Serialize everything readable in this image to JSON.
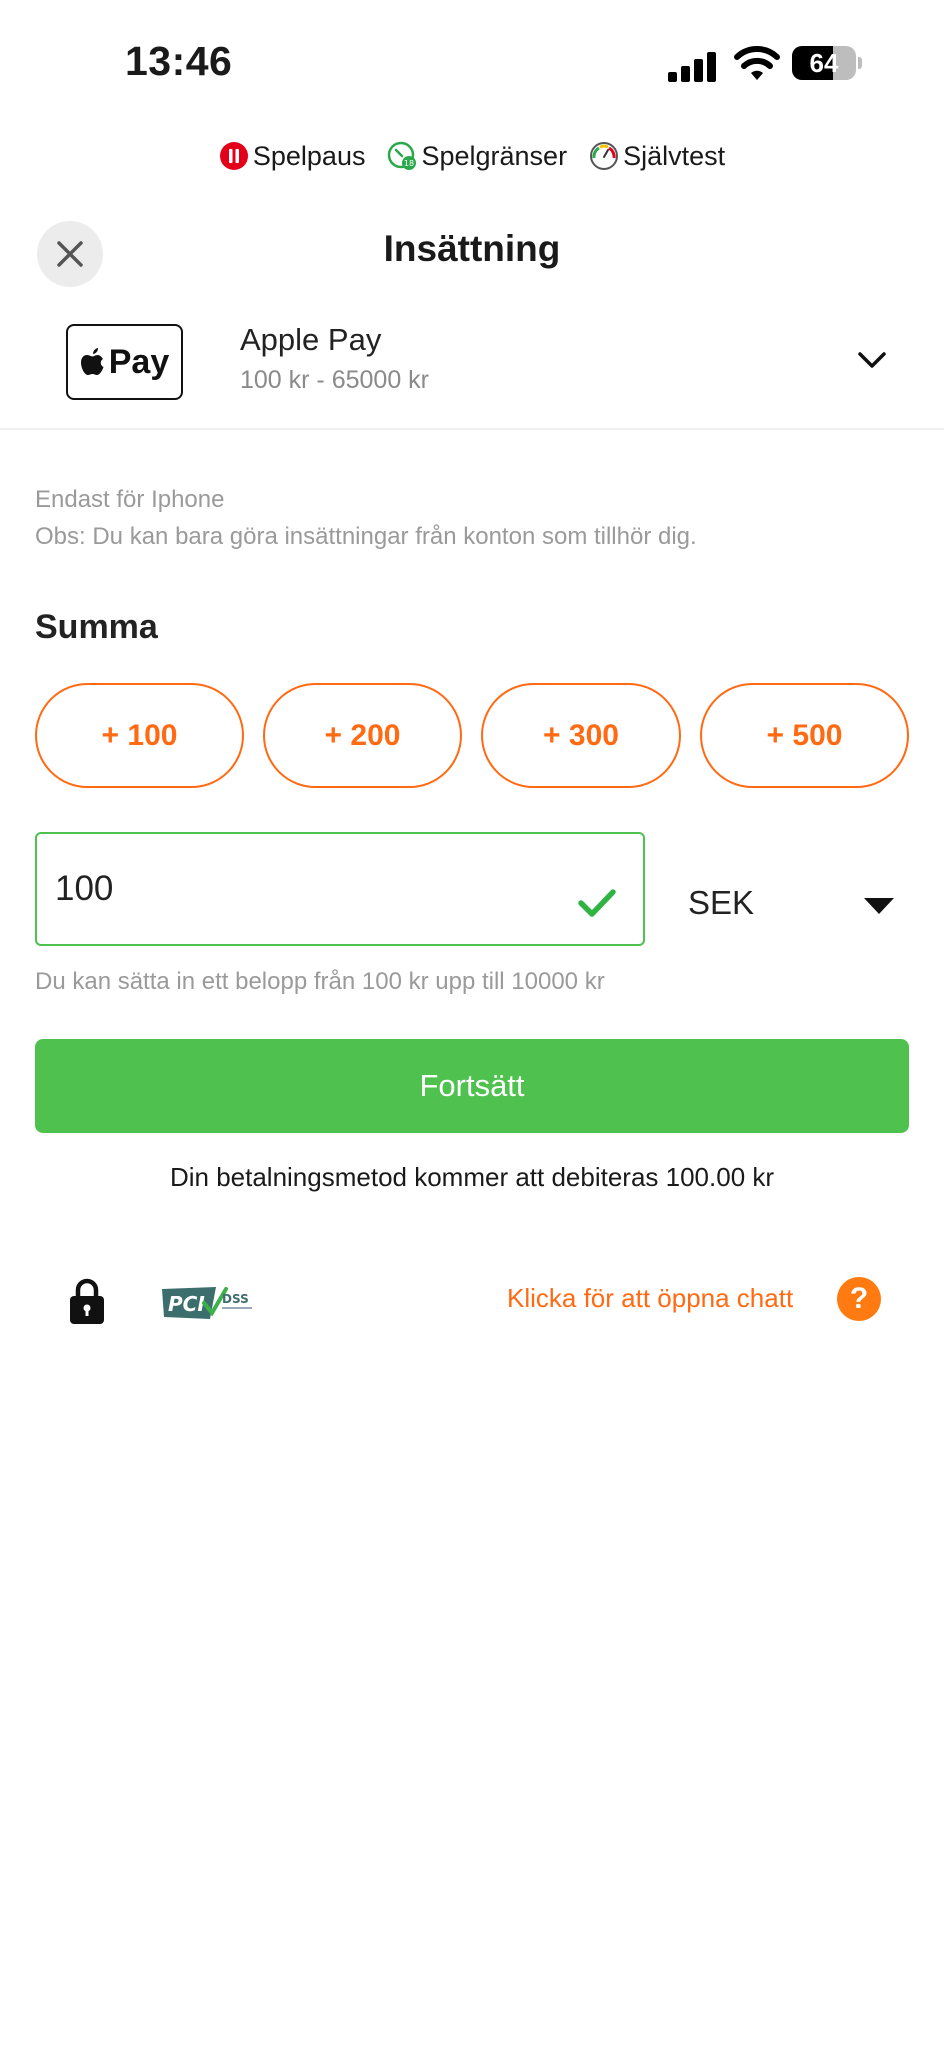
{
  "status_bar": {
    "time": "13:46",
    "battery_level": "64",
    "battery_fraction": 0.64
  },
  "rg_links": [
    {
      "label": "Spelpaus",
      "icon": "pause-circle-icon"
    },
    {
      "label": "Spelgränser",
      "icon": "limits-icon"
    },
    {
      "label": "Självtest",
      "icon": "gauge-icon"
    }
  ],
  "header": {
    "title": "Insättning",
    "close_icon": "close-icon"
  },
  "payment_method": {
    "badge_text": "Pay",
    "name": "Apple Pay",
    "range": "100 kr - 65000 kr",
    "chevron_icon": "chevron-down-icon"
  },
  "notes": {
    "line1": "Endast för Iphone",
    "line2": "Obs: Du kan bara göra insättningar från konton som tillhör dig."
  },
  "amount": {
    "label": "Summa",
    "quick_buttons": [
      "+ 100",
      "+ 200",
      "+ 300",
      "+ 500"
    ],
    "value": "100",
    "currency": "SEK",
    "hint": "Du kan sätta in ett belopp från 100 kr upp till 10000 kr"
  },
  "cta": {
    "label": "Fortsätt"
  },
  "debit_text": "Din betalningsmetod kommer att debiteras 100.00 kr",
  "footer": {
    "chat_link": "Klicka för att öppna chatt",
    "help_symbol": "?",
    "lock_icon": "lock-icon",
    "pci_logo": "pci-dss-logo"
  },
  "colors": {
    "accent": "#ff6a13",
    "success": "#4fc14f",
    "muted": "#9a9a9a"
  }
}
